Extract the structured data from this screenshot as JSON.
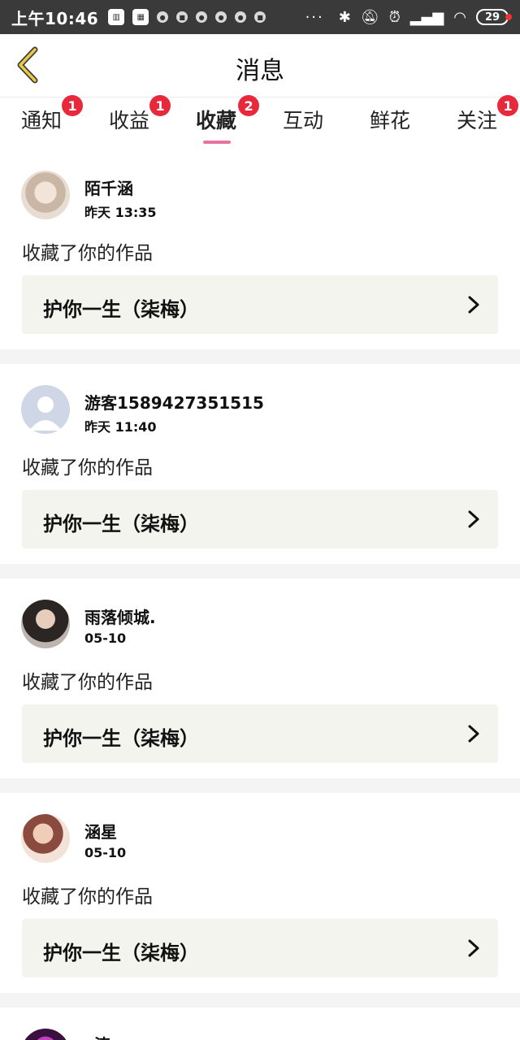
{
  "status_bar": {
    "time": "上午10:46",
    "notification_icons": [
      "sim-icon",
      "qr-icon",
      "bulb-icon",
      "calendar-icon",
      "app-icon",
      "app-icon",
      "app-icon",
      "calendar-icon"
    ],
    "overflow": "···",
    "battery": "29",
    "right_icons": [
      "bluetooth-icon",
      "mute-icon",
      "alarm-icon",
      "signal-icon",
      "wifi-icon"
    ]
  },
  "header": {
    "title": "消息",
    "back_icon": "back-arrow-icon",
    "accent_color": "#e9c94a"
  },
  "tabs": [
    {
      "label": "通知",
      "badge": "1"
    },
    {
      "label": "收益",
      "badge": "1"
    },
    {
      "label": "收藏",
      "badge": "2",
      "active": true
    },
    {
      "label": "互动",
      "badge": ""
    },
    {
      "label": "鲜花",
      "badge": ""
    },
    {
      "label": "关注",
      "badge": "1"
    }
  ],
  "items": [
    {
      "user": "陌千涵",
      "time": "昨天 13:35",
      "action": "收藏了你的作品",
      "work": "护你一生（柒梅）"
    },
    {
      "user": "游客1589427351515",
      "time": "昨天 11:40",
      "action": "收藏了你的作品",
      "work": "护你一生（柒梅）"
    },
    {
      "user": "雨落倾城.",
      "time": "05-10",
      "action": "收藏了你的作品",
      "work": "护你一生（柒梅）"
    },
    {
      "user": "涵星",
      "time": "05-10",
      "action": "收藏了你的作品",
      "work": "护你一生（柒梅）"
    },
    {
      "user": "c涛",
      "time": "",
      "action": "",
      "work": ""
    }
  ],
  "colors": {
    "badge": "#e8293b",
    "tab_underline": "#e8729f",
    "work_box_bg": "#f4f4ee",
    "separator": "#f4f4f4"
  }
}
